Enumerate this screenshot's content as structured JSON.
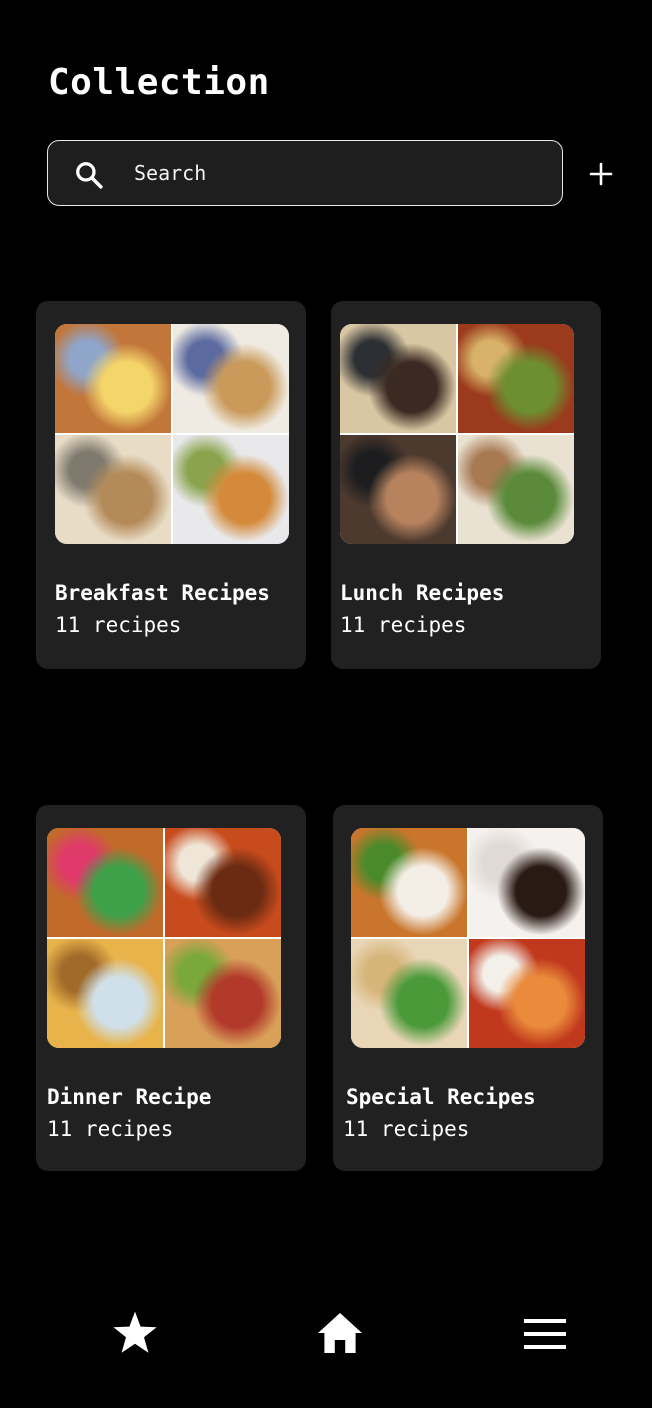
{
  "header": {
    "title": "Collection"
  },
  "search": {
    "placeholder": "Search",
    "value": ""
  },
  "add_button": {
    "icon": "plus-icon"
  },
  "collections": [
    {
      "name": "Breakfast Recipes",
      "count": "11 recipes",
      "tiles": [
        {
          "colors": [
            "#c2763a",
            "#f4d56a",
            "#8fa5c9"
          ]
        },
        {
          "colors": [
            "#f0ebe2",
            "#c99a5a",
            "#5b6aa0"
          ]
        },
        {
          "colors": [
            "#e8dcc6",
            "#b38a58",
            "#7f7a6e"
          ]
        },
        {
          "colors": [
            "#e9e9ec",
            "#d48a3a",
            "#8aa34c"
          ]
        }
      ]
    },
    {
      "name": "Lunch Recipes",
      "count": "11 recipes",
      "tiles": [
        {
          "colors": [
            "#d9c6a2",
            "#3b2a22",
            "#2c2f33"
          ]
        },
        {
          "colors": [
            "#9b3a1c",
            "#6d8f32",
            "#d7b268"
          ]
        },
        {
          "colors": [
            "#4d3a2f",
            "#b7835f",
            "#1d1d1f"
          ]
        },
        {
          "colors": [
            "#e9e1d1",
            "#5a8a3a",
            "#a77a53"
          ]
        }
      ]
    },
    {
      "name": "Dinner Recipe",
      "count": "11 recipes",
      "tiles": [
        {
          "colors": [
            "#c26a2a",
            "#3fa04a",
            "#e03a6a"
          ]
        },
        {
          "colors": [
            "#c74b1d",
            "#6b2b12",
            "#f0e6d8"
          ]
        },
        {
          "colors": [
            "#e8b34a",
            "#cfe0ea",
            "#a06a2a"
          ]
        },
        {
          "colors": [
            "#d9a05a",
            "#b23a2a",
            "#7aa83a"
          ]
        }
      ]
    },
    {
      "name": "Special Recipes",
      "count": "11 recipes",
      "tiles": [
        {
          "colors": [
            "#c9762c",
            "#f3eee6",
            "#4a8a2a"
          ]
        },
        {
          "colors": [
            "#f5f1ee",
            "#2a1a14",
            "#e0dad6"
          ]
        },
        {
          "colors": [
            "#e9d6b6",
            "#4a9a3a",
            "#d6b57a"
          ]
        },
        {
          "colors": [
            "#c0391d",
            "#ea8a3a",
            "#f3efe9"
          ]
        }
      ]
    }
  ],
  "bottom_nav": {
    "items": [
      {
        "icon": "star-icon",
        "name": "favorites"
      },
      {
        "icon": "home-icon",
        "name": "home"
      },
      {
        "icon": "menu-icon",
        "name": "menu"
      }
    ]
  },
  "colors": {
    "background": "#000000",
    "card": "#212121",
    "search_bg": "#1e1e1e",
    "text": "#ffffff"
  }
}
